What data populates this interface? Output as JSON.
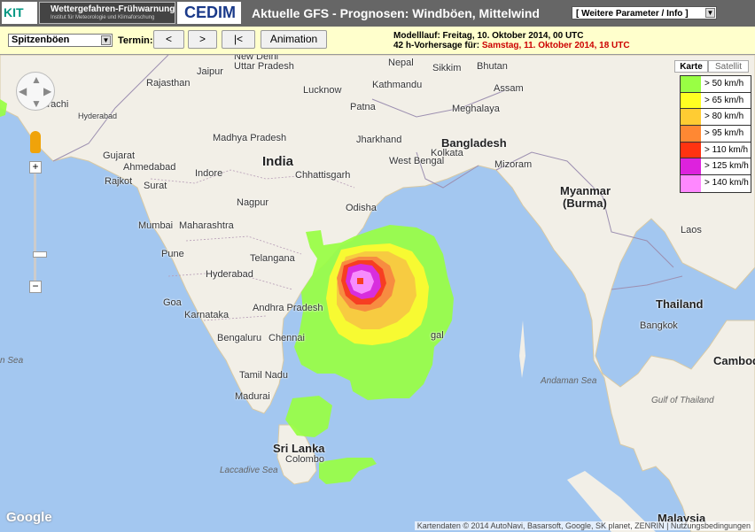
{
  "header": {
    "kit_logo": "KIT",
    "warn_title": "Wettergefahren-Frühwarnung",
    "warn_subtitle": "Institut für Meteorologie und Klimaforschung",
    "cedim_logo": "CEDIM",
    "title": "Aktuelle GFS - Prognosen: Windböen, Mittelwind",
    "param_select": "[ Weitere Parameter / Info ]"
  },
  "toolbar": {
    "type_select": "Spitzenböen",
    "termin_label": "Termin:",
    "prev_label": "<",
    "next_label": ">",
    "first_label": "|<",
    "animation_label": "Animation",
    "modell_label": "Modelllauf: Freitag, 10. Oktober 2014, 00 UTC",
    "vorhersage_label": "42 h-Vorhersage für:",
    "vorhersage_value": "Samstag, 11. Oktober 2014, 18 UTC"
  },
  "map": {
    "type_map": "Karte",
    "type_satellite": "Satellit",
    "google_logo": "Google",
    "attribution": "Kartendaten © 2014 AutoNavi, Basarsoft, Google, SK planet, ZENRIN  |  Nutzungsbedingungen",
    "labels": {
      "new_delhi": "New Delhi",
      "jaipur": "Jaipur",
      "uttar_pradesh": "Uttar Pradesh",
      "kathmandu": "Kathmandu",
      "nepal": "Nepal",
      "sikkim": "Sikkim",
      "bhutan": "Bhutan",
      "rajasthan": "Rajasthan",
      "lucknow": "Lucknow",
      "assam": "Assam",
      "karachi": "Karachi",
      "hyderabad_pk": "Hyderabad",
      "patna": "Patna",
      "meghalaya": "Meghalaya",
      "madhya_pradesh": "Madhya Pradesh",
      "jharkhand": "Jharkhand",
      "bangladesh": "Bangladesh",
      "gujarat": "Gujarat",
      "india": "India",
      "ahmedabad": "Ahmedabad",
      "kolkata": "Kolkata",
      "west_bengal": "West Bengal",
      "mizoram": "Mizoram",
      "rajkot": "Rajkot",
      "surat": "Surat",
      "indore": "Indore",
      "chhattisgarh": "Chhattisgarh",
      "myanmar": "Myanmar",
      "burma": "(Burma)",
      "nagpur": "Nagpur",
      "odisha": "Odisha",
      "mumbai": "Mumbai",
      "maharashtra": "Maharashtra",
      "laos": "Laos",
      "pune": "Pune",
      "telangana": "Telangana",
      "hyderabad": "Hyderabad",
      "goa": "Goa",
      "andhra_pradesh": "Andhra Pradesh",
      "karnataka": "Karnataka",
      "thailand": "Thailand",
      "bengaluru": "Bengaluru",
      "chennai": "Chennai",
      "bangkok": "Bangkok",
      "cambodia": "Cambodia",
      "tamil_nadu": "Tamil Nadu",
      "madurai": "Madurai",
      "sri_lanka": "Sri Lanka",
      "colombo": "Colombo",
      "malaysia": "Malaysia",
      "andaman_sea": "Andaman Sea",
      "gulf_thailand": "Gulf of Thailand",
      "laccadive_sea": "Laccadive Sea",
      "arabian_sea": "n Sea",
      "bay_partial": "gal"
    }
  },
  "legend": [
    {
      "label": "> 50 km/h",
      "color": "#99ff44"
    },
    {
      "label": "> 65 km/h",
      "color": "#ffff22"
    },
    {
      "label": "> 80 km/h",
      "color": "#ffcc33"
    },
    {
      "label": "> 95 km/h",
      "color": "#ff8833"
    },
    {
      "label": "> 110 km/h",
      "color": "#ff3311"
    },
    {
      "label": "> 125 km/h",
      "color": "#dd22dd"
    },
    {
      "label": "> 140 km/h",
      "color": "#ff88ff"
    }
  ]
}
